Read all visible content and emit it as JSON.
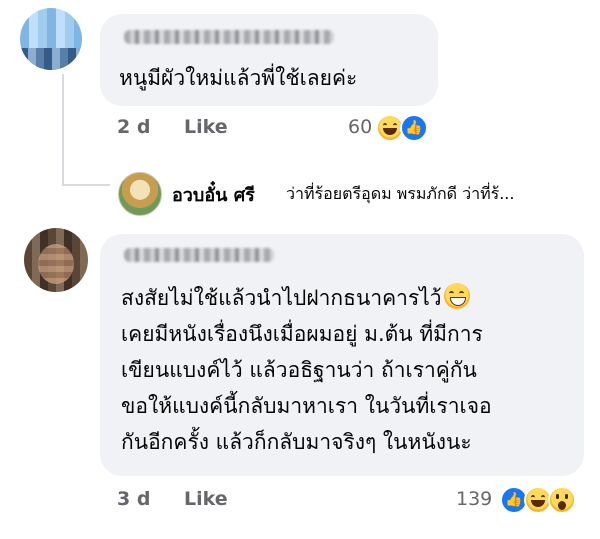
{
  "comment1": {
    "text": "หนูมีผัวใหม่แล้วพี่ใช้เลยค่ะ",
    "time": "2 d",
    "like_label": "Like",
    "reaction_count": "60",
    "reactions": [
      "laugh-emoji-icon",
      "like-icon"
    ]
  },
  "reply_preview": {
    "author": "อวบอั๋น ศรี",
    "text": "ว่าที่ร้อยตรีอุดม พรมภักดี ว่าที่ร้..."
  },
  "comment2": {
    "lines": [
      "สงสัยไม่ใช้แล้วนำไปฝากธนาคารไว้",
      "เคยมีหนังเรื่องนึงเมื่อผมอยู่ ม.ต้น ที่มีการ",
      "เขียนแบงค์ไว้ แล้วอธิฐานว่า ถ้าเราคู่กัน",
      "ขอให้แบงค์นี้กลับมาหาเรา ในวันที่เราเจอ",
      "กันอีกครั้ง แล้วก็กลับมาจริงๆ ในหนังนะ"
    ],
    "time": "3 d",
    "like_label": "Like",
    "reaction_count": "139",
    "reactions": [
      "like-icon",
      "laugh-emoji-icon",
      "wow-emoji-icon"
    ]
  },
  "icons": {
    "like_glyph": "👍"
  },
  "colors": {
    "bubble": "#f0f2f5",
    "meta": "#65676b",
    "like_blue": "#1877f2"
  }
}
